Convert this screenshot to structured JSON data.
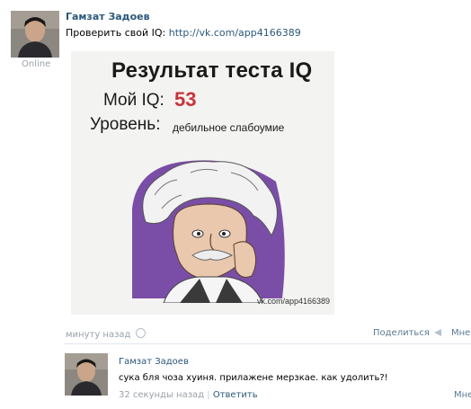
{
  "post": {
    "author": "Гамзат Задоев",
    "online": "Online",
    "text_prefix": "Проверить свой IQ: ",
    "link": "http://vk.com/app4166389",
    "time": "минуту назад",
    "share_label": "Поделиться",
    "more_label": "Мне"
  },
  "card": {
    "title": "Результат теста IQ",
    "iq_label": "Мой IQ:",
    "iq_value": "53",
    "level_label": "Уровень:",
    "level_value": "дебильное слабоумие",
    "footer_url": "vk.com/app4166389",
    "iq_color": "#c8343a"
  },
  "comment": {
    "author": "Гамзат Задоев",
    "text": "сука бля чоза хуиня. прилажене мерзкае. как удолить?!",
    "time": "32 секунды назад",
    "separator": "|",
    "reply_label": "Ответить",
    "more_label": "Мне"
  },
  "icons": {
    "time_icon": "clock-icon",
    "share_icon": "megaphone-icon"
  },
  "colors": {
    "link": "#2b587a",
    "meta": "#9aa1a8",
    "card_bg": "#f3f3f1"
  }
}
